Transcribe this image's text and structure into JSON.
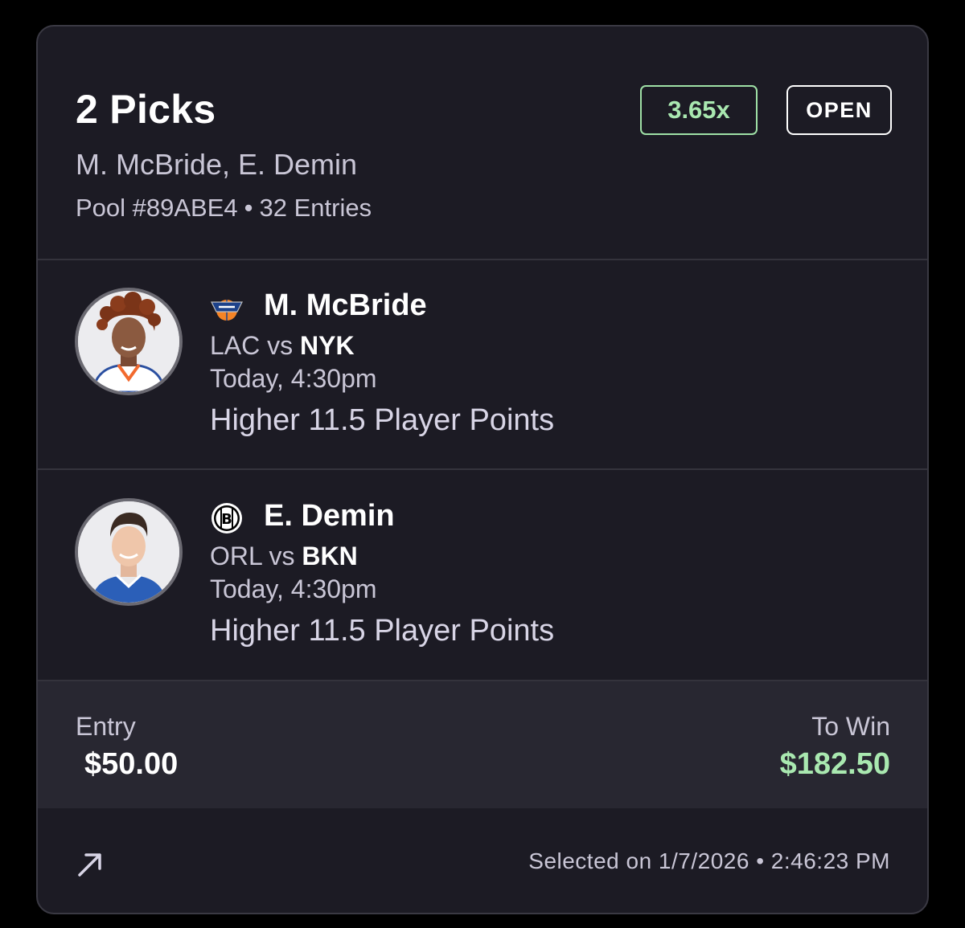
{
  "entry_card": {
    "title": "2 Picks",
    "players_summary": "M. McBride, E. Demin",
    "pool_id": "Pool #89ABE4",
    "entries_count": "32 Entries",
    "multiplier": "3.65x",
    "status": "OPEN"
  },
  "picks": [
    {
      "player": "M. McBride",
      "team_icon": "knicks-logo-icon",
      "away": "LAC",
      "vs": "vs",
      "home": "NYK",
      "time": "Today, 4:30pm",
      "line": "Higher 11.5 Player Points"
    },
    {
      "player": "E. Demin",
      "team_icon": "nets-logo-icon",
      "away": "ORL",
      "vs": "vs",
      "home": "BKN",
      "time": "Today, 4:30pm",
      "line": "Higher 11.5 Player Points"
    }
  ],
  "totals": {
    "entry_label": "Entry",
    "entry_value": "$50.00",
    "win_label": "To Win",
    "win_value": "$182.50"
  },
  "footer": {
    "share_icon": "share-arrow-icon",
    "selected_text": "Selected on 1/7/2026 • 2:46:23 PM"
  },
  "colors": {
    "background": "#000000",
    "card": "#1c1b24",
    "totals_panel": "#282731",
    "accent_green": "#a9e8b0",
    "muted_text": "#c9c6d6"
  }
}
